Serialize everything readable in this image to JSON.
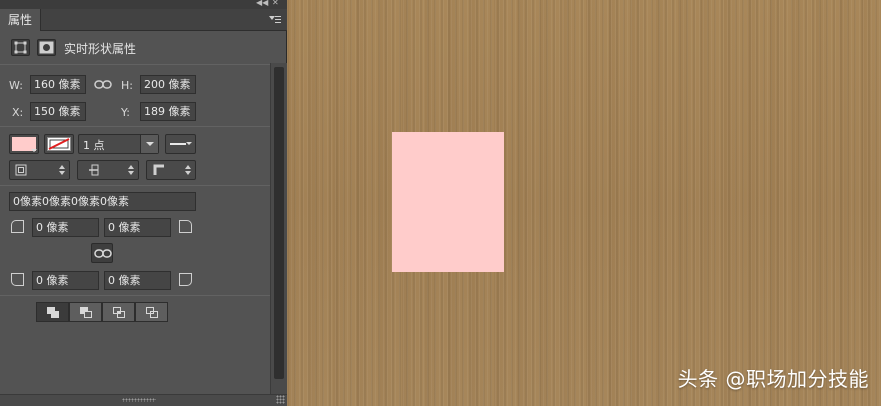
{
  "panel": {
    "tab_label": "属性",
    "header_title": "实时形状属性"
  },
  "transform": {
    "w_label": "W:",
    "w_value": "160 像素",
    "h_label": "H:",
    "h_value": "200 像素",
    "x_label": "X:",
    "x_value": "150 像素",
    "y_label": "Y:",
    "y_value": "189 像素"
  },
  "appearance": {
    "fill_color": "#ffcccb",
    "stroke_width": "1 点"
  },
  "corners": {
    "combined_value": "0像素0像素0像素0像素",
    "top_left": "0 像素",
    "top_right": "0 像素",
    "bottom_left": "0 像素",
    "bottom_right": "0 像素"
  },
  "canvas": {
    "background_color": "#a6855a",
    "shape_color": "#ffcccb",
    "watermark": "头条 @职场加分技能"
  }
}
